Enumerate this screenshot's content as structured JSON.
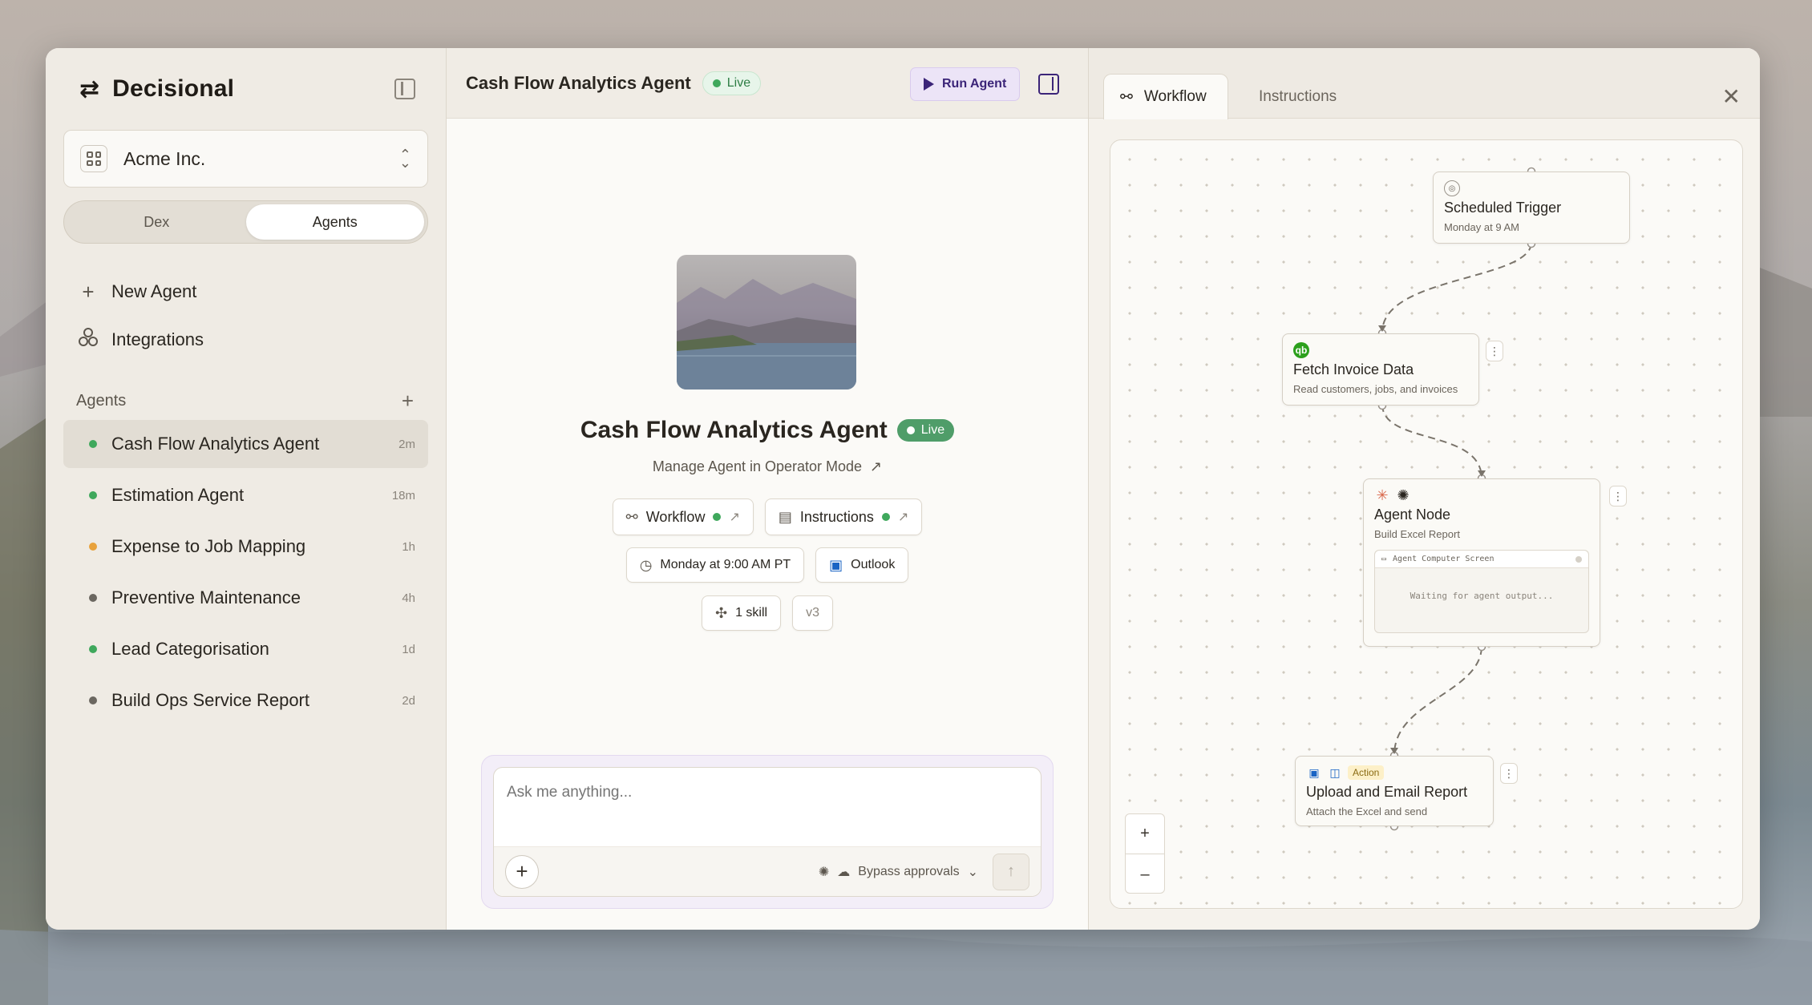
{
  "app": {
    "name": "Decisional"
  },
  "sidebar": {
    "org": "Acme Inc.",
    "segments": [
      "Dex",
      "Agents"
    ],
    "active_segment": "Agents",
    "actions": [
      {
        "label": "New Agent",
        "icon": "plus-icon"
      },
      {
        "label": "Integrations",
        "icon": "integrations-icon"
      }
    ],
    "agents_heading": "Agents",
    "agents": [
      {
        "name": "Cash Flow Analytics Agent",
        "time": "2m",
        "status_color": "#3fa85c",
        "selected": true
      },
      {
        "name": "Estimation Agent",
        "time": "18m",
        "status_color": "#3fa85c"
      },
      {
        "name": "Expense to Job Mapping",
        "time": "1h",
        "status_color": "#e8a23c"
      },
      {
        "name": "Preventive Maintenance",
        "time": "4h",
        "status_color": "#6b6760"
      },
      {
        "name": "Lead Categorisation",
        "time": "1d",
        "status_color": "#3fa85c"
      },
      {
        "name": "Build Ops Service Report",
        "time": "2d",
        "status_color": "#6b6760"
      }
    ]
  },
  "middle": {
    "header_title": "Cash Flow Analytics Agent",
    "live_label": "Live",
    "run_label": "Run Agent",
    "agent_title": "Cash Flow Analytics Agent",
    "manage_label": "Manage Agent in Operator Mode",
    "chips": {
      "workflow": "Workflow",
      "instructions": "Instructions",
      "schedule": "Monday at 9:00 AM PT",
      "integration": "Outlook",
      "skills": "1 skill",
      "version": "v3"
    },
    "chat": {
      "placeholder": "Ask me anything...",
      "bypass_label": "Bypass approvals"
    }
  },
  "right": {
    "tabs": [
      "Workflow",
      "Instructions"
    ],
    "active_tab": "Workflow",
    "nodes": {
      "trigger": {
        "title": "Scheduled Trigger",
        "sub": "Monday at 9 AM"
      },
      "fetch": {
        "title": "Fetch Invoice Data",
        "sub": "Read customers, jobs, and invoices"
      },
      "agent": {
        "title": "Agent Node",
        "sub": "Build Excel Report",
        "screen_label": "Agent Computer Screen",
        "screen_status": "Waiting for agent output..."
      },
      "upload": {
        "badge": "Action",
        "title": "Upload and Email Report",
        "sub": "Attach the Excel and send"
      }
    },
    "zoom": {
      "in": "+",
      "out": "–"
    }
  },
  "colors": {
    "accent": "#3b2478",
    "live_green": "#3fa85c"
  }
}
